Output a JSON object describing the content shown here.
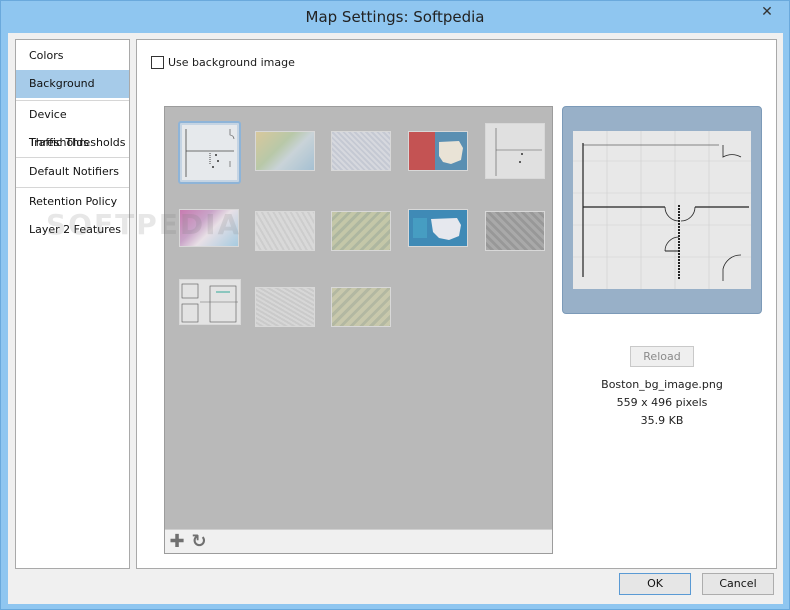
{
  "window": {
    "title": "Map Settings: Softpedia",
    "close_glyph": "✕"
  },
  "sidebar": {
    "items": [
      {
        "label": "Colors"
      },
      {
        "label": "Background"
      },
      {
        "label": "Device Thresholds"
      },
      {
        "label": "Traffic Thresholds"
      },
      {
        "label": "Default Notifiers"
      },
      {
        "label": "Retention Policy"
      },
      {
        "label": "Layer 2 Features"
      }
    ],
    "selected": "Background"
  },
  "watermark": "SOFTPEDIA",
  "background": {
    "use_background_image_label": "Use background image",
    "use_background_image_checked": false,
    "gallery_toolbar": {
      "add_icon": "plus-icon",
      "refresh_icon": "refresh-icon"
    },
    "preview": {
      "reload_label": "Reload",
      "filename": "Boston_bg_image.png",
      "dimensions": "559 x 496 pixels",
      "size": "35.9 KB"
    }
  },
  "footer": {
    "ok_label": "OK",
    "cancel_label": "Cancel"
  },
  "colors": {
    "selected_nav": "#a6cbe9",
    "preview_frame": "#98b0c8",
    "gallery_bg": "#b9b9b9"
  }
}
